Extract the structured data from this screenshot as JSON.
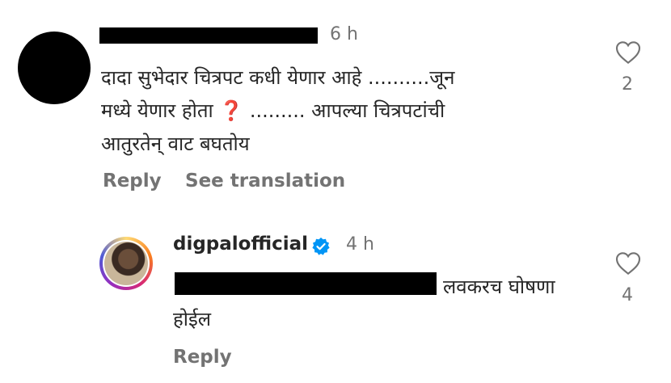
{
  "comment": {
    "time": "6 h",
    "text_lines": [
      "दादा  सुभेदार चित्रपट कधी येणार आहे ..........जून",
      "मध्ये येणार होता",
      " ......... आपल्या चित्रपटांची",
      "आतुरतेन् वाट बघतोय"
    ],
    "qmark": "❓",
    "reply_label": "Reply",
    "translate_label": "See translation",
    "like_count": "2"
  },
  "reply": {
    "username": "digpalofficial",
    "time": "4 h",
    "text_line1": "लवकरच घोषणा",
    "text_line2": "होईल",
    "reply_label": "Reply",
    "like_count": "4"
  },
  "icons": {
    "like": "heart-outline-icon",
    "verified": "verified-badge-icon"
  },
  "colors": {
    "secondary_text": "#737373",
    "verified_blue": "#0095f6",
    "question_red": "#d0021b"
  }
}
